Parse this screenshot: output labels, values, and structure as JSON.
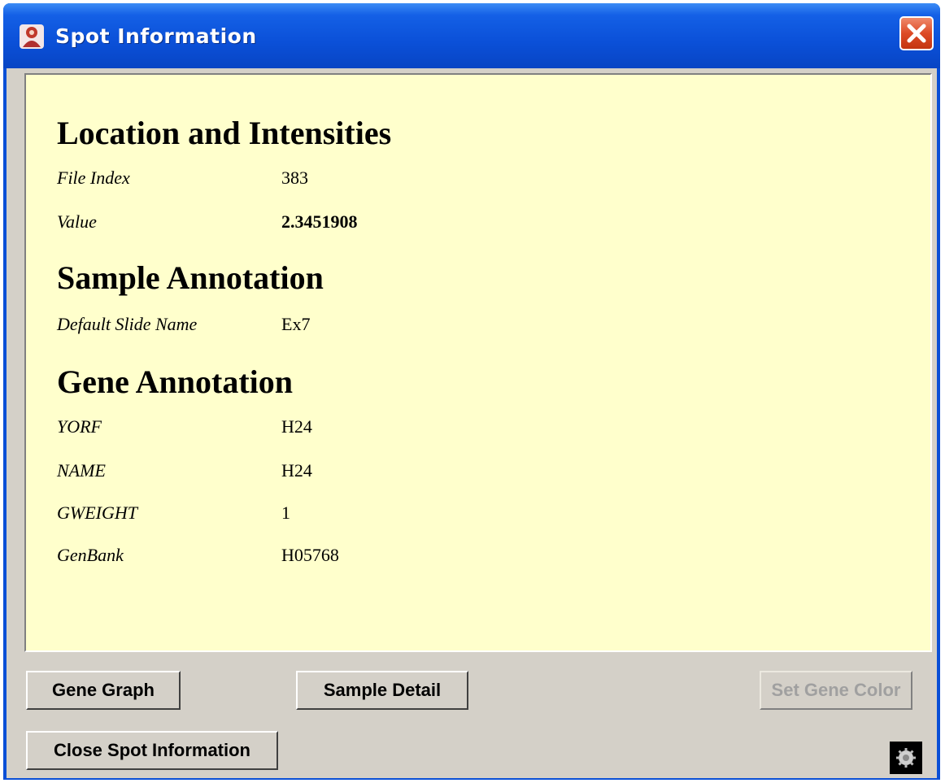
{
  "window": {
    "title": "Spot Information",
    "icon": "app-logo-icon"
  },
  "sections": [
    {
      "title": "Location and Intensities",
      "rows": [
        {
          "label": "File Index",
          "value": "383"
        },
        {
          "label": "Value",
          "value": "2.3451908"
        }
      ]
    },
    {
      "title": "Sample Annotation",
      "rows": [
        {
          "label": "Default Slide Name",
          "value": "Ex7"
        }
      ]
    },
    {
      "title": "Gene Annotation",
      "rows": [
        {
          "label": "YORF",
          "value": "H24"
        },
        {
          "label": "NAME",
          "value": "H24"
        },
        {
          "label": "GWEIGHT",
          "value": "1"
        },
        {
          "label": "GenBank",
          "value": "H05768"
        }
      ]
    }
  ],
  "buttons": {
    "gene_graph": "Gene Graph",
    "sample_detail": "Sample Detail",
    "set_gene_color": "Set Gene Color",
    "close_spot_information": "Close Spot Information"
  },
  "colors": {
    "title_bar": "#0b50d8",
    "panel_background": "#ffffcc",
    "dialog_background": "#d4d0c8",
    "close_button": "#dd4b27"
  }
}
